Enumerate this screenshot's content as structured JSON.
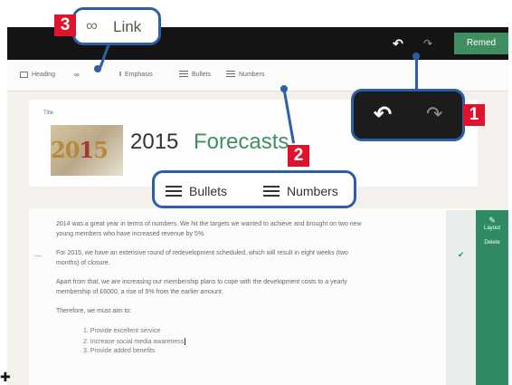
{
  "header": {
    "remix_label": "Remed"
  },
  "toolbar": {
    "heading": "Heading",
    "emphasis": "Emphasis",
    "bullets": "Bullets",
    "numbers": "Numbers"
  },
  "title_card": {
    "tag": "Title",
    "title_part1": "2015",
    "title_part2": "Forecasts",
    "thumb_text_a": "20",
    "thumb_text_b": "1",
    "thumb_text_c": "5"
  },
  "content": {
    "paragraphs": [
      "2014 was a great year in terms of numbers. We hit the targets we wanted to achieve and brought on two new",
      "young members who have increased revenue by 5%.",
      "For 2015, we have an extensive round of redevelopment scheduled, which will result in eight weeks (two",
      "months) of closure.",
      "Apart from that, we are increasing our membership plans to cope with the development costs to a yearly",
      "membership of £6000, a rise of 5% from the earlier amount.",
      "Therefore, we must aim to:"
    ],
    "list": [
      "1.  Provide excellent service",
      "2.  Increase social media awareness",
      "3.  Provide added benefits"
    ],
    "dash": "—"
  },
  "side_panel": {
    "layout_label": "Layout",
    "delete_label": "Delete"
  },
  "callouts": {
    "link_label": "Link",
    "bullets_label": "Bullets",
    "numbers_label": "Numbers",
    "badge_1": "1",
    "badge_2": "2",
    "badge_3": "3"
  },
  "colors": {
    "accent_green": "#3f8f62",
    "callout_blue": "#2d5fa8",
    "badge_red": "#e0122d"
  }
}
